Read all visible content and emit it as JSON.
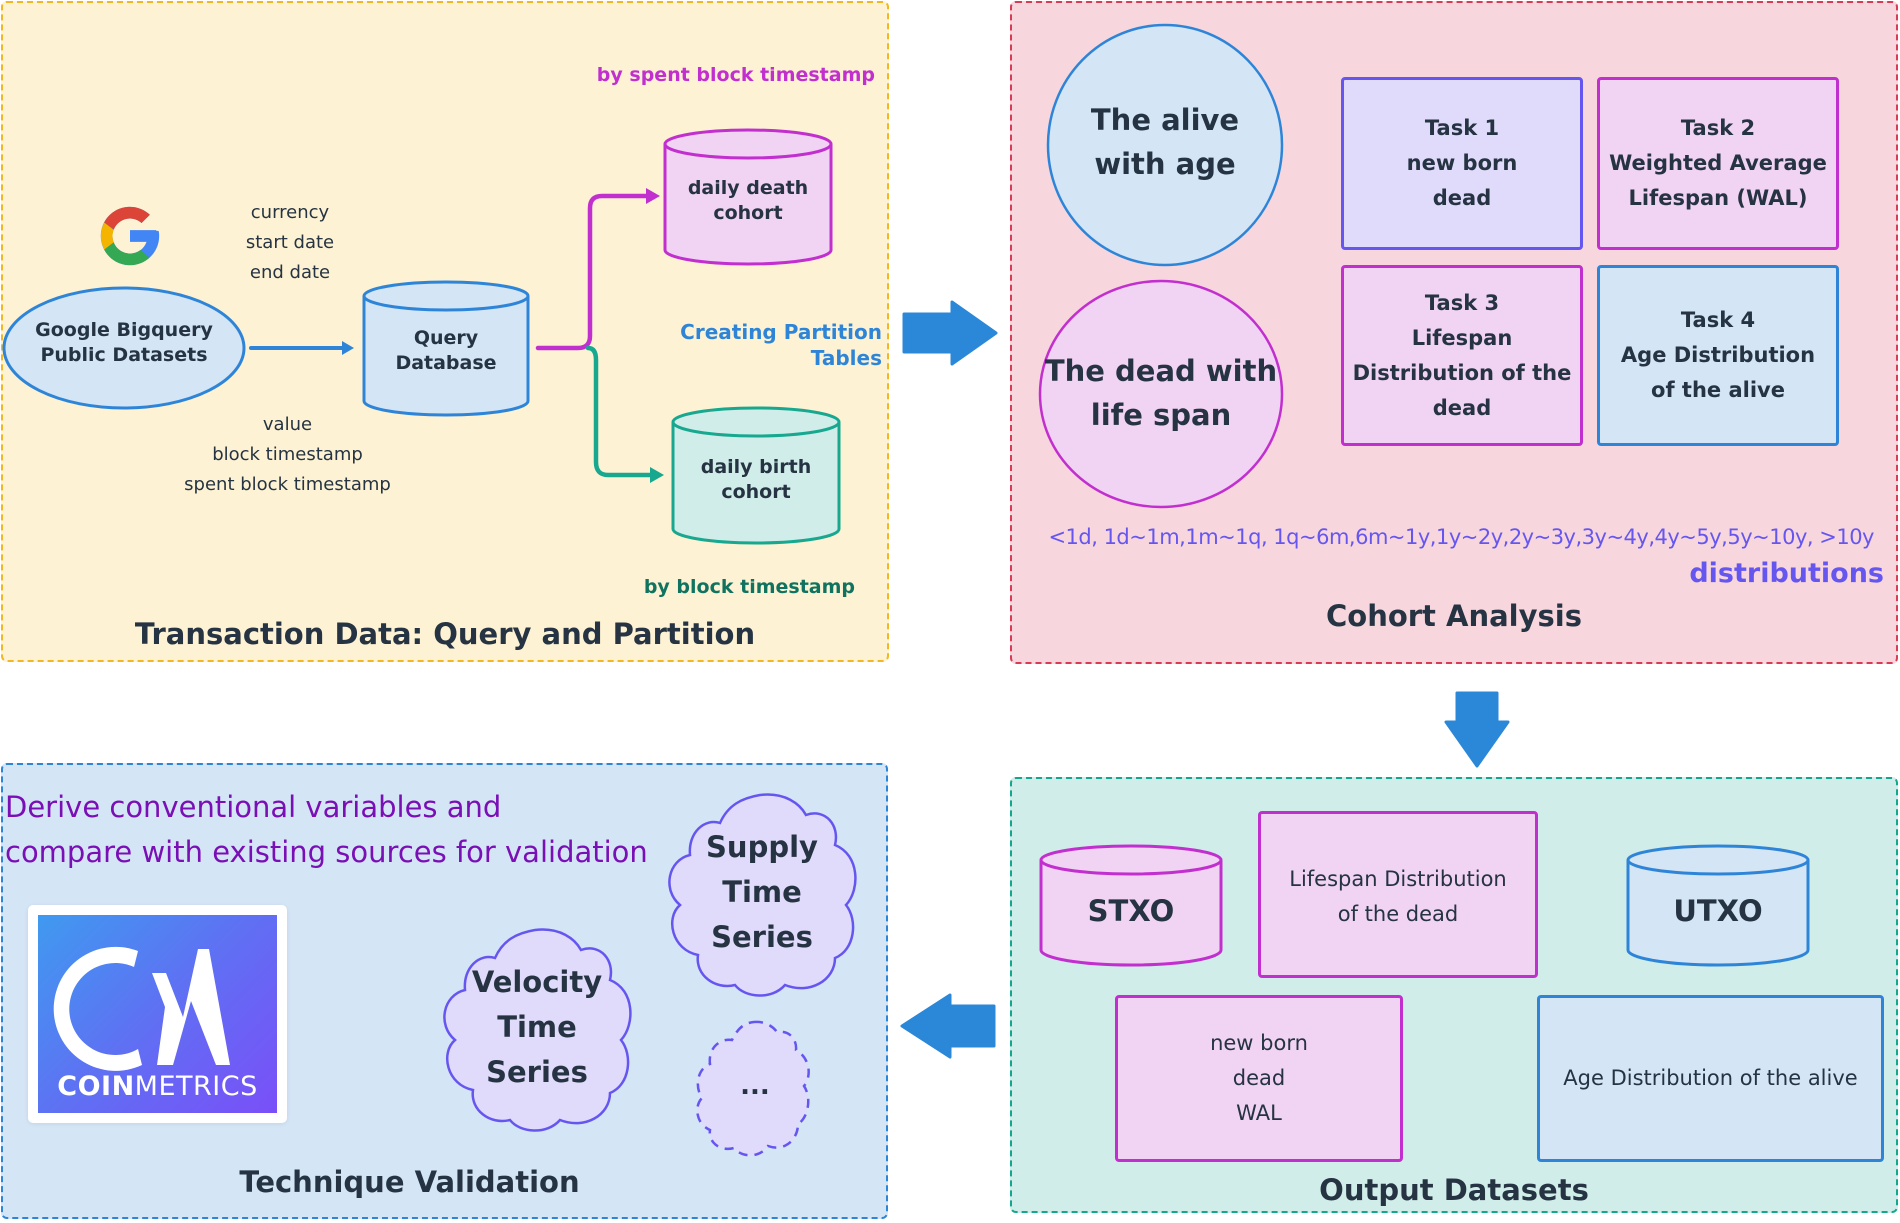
{
  "panels": {
    "transaction": {
      "title": "Transaction Data: Query and Partition",
      "source": {
        "label_lines": [
          "Google Bigquery",
          "Public Datasets"
        ],
        "icon": "google-g-icon"
      },
      "input_params": [
        "currency",
        "start date",
        "end date"
      ],
      "output_fields": [
        "value",
        "block timestamp",
        "spent block timestamp"
      ],
      "query_db": {
        "label_lines": [
          "Query",
          "Database"
        ]
      },
      "partition_label": "Creating Partition Tables",
      "death_cohort": {
        "label_lines": [
          "daily death",
          "cohort"
        ],
        "partition_key": "by spent block timestamp"
      },
      "birth_cohort": {
        "label_lines": [
          "daily birth",
          "cohort"
        ],
        "partition_key": "by block timestamp"
      }
    },
    "cohort": {
      "title": "Cohort Analysis",
      "alive": {
        "label_lines": [
          "The alive",
          "with age"
        ]
      },
      "dead": {
        "label_lines": [
          "The dead with",
          "life span"
        ]
      },
      "tasks": [
        {
          "lines": [
            "Task 1",
            "new born",
            "dead"
          ]
        },
        {
          "lines": [
            "Task 2",
            "Weighted Average",
            "Lifespan (WAL)"
          ]
        },
        {
          "lines": [
            "Task 3",
            "Lifespan",
            "Distribution of the",
            "dead"
          ]
        },
        {
          "lines": [
            "Task 4",
            "Age Distribution",
            "of the alive"
          ]
        }
      ],
      "buckets": "<1d, 1d~1m,1m~1q, 1q~6m,6m~1y,1y~2y,2y~3y,3y~4y,4y~5y,5y~10y, >10y",
      "buckets_label": "distributions"
    },
    "validation": {
      "title": "Technique Validation",
      "description_lines": [
        "Derive conventional variables and",
        "compare with existing sources for validation"
      ],
      "logo": {
        "mark": "CM",
        "name_bold": "COIN",
        "name_light": "METRICS"
      },
      "clouds": [
        {
          "lines": [
            "Supply",
            "Time",
            "Series"
          ]
        },
        {
          "lines": [
            "Velocity",
            "Time",
            "Series"
          ]
        },
        {
          "lines": [
            "..."
          ]
        }
      ]
    },
    "outputs": {
      "title": "Output Datasets",
      "stxo": "STXO",
      "utxo": "UTXO",
      "lifespan_box": [
        "Lifespan Distribution",
        "of the dead"
      ],
      "newborn_box": [
        "new born",
        "dead",
        "WAL"
      ],
      "age_box": [
        "Age Distribution of the alive"
      ]
    }
  },
  "colors": {
    "blue": "#2e85d8",
    "purple": "#c22fcf",
    "teal": "#17a88f",
    "violet": "#6656f0",
    "text_dark": "#253342"
  }
}
